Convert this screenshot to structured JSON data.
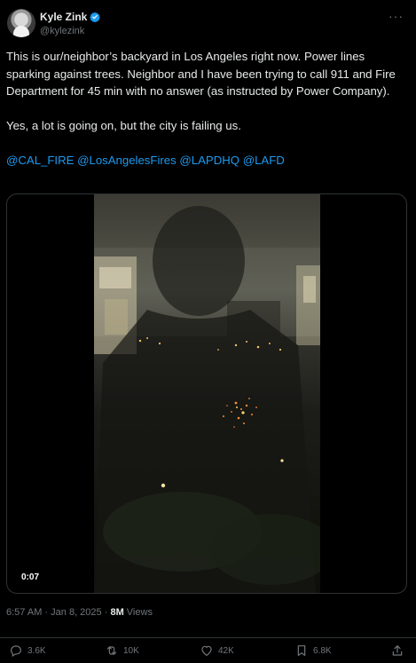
{
  "author": {
    "display_name": "Kyle Zink",
    "handle": "@kylezink",
    "verified": true
  },
  "tweet": {
    "paragraphs": [
      "This is our/neighbor’s backyard in Los Angeles right now. Power lines sparking against trees. Neighbor and I have been trying to call 911 and Fire Department for 45 min with no answer (as instructed by Power Company).",
      "Yes, a lot is going on, but the city is failing us."
    ],
    "mentions": [
      "@CAL_FIRE",
      "@LosAngelesFires",
      "@LAPDHQ",
      "@LAFD"
    ]
  },
  "video": {
    "timestamp": "0:07"
  },
  "meta": {
    "time": "6:57 AM",
    "separator": "·",
    "date": "Jan 8, 2025",
    "views_count": "8M",
    "views_label": "Views"
  },
  "actions": {
    "replies": "3.6K",
    "reposts": "10K",
    "likes": "42K",
    "bookmarks": "6.8K"
  },
  "colors": {
    "background": "#000000",
    "text": "#e7e9ea",
    "muted": "#71767b",
    "link": "#1d9bf0",
    "border": "#2f3336"
  }
}
